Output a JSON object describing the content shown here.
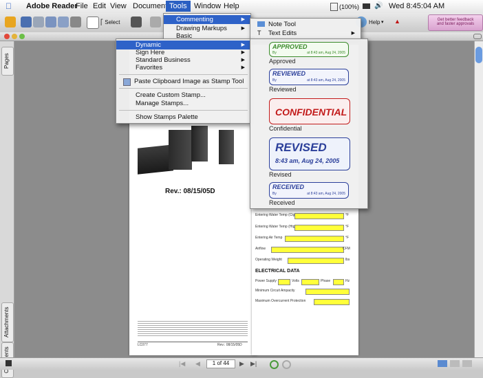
{
  "menubar": {
    "app": "Adobe Reader",
    "items": [
      "File",
      "Edit",
      "View",
      "Document",
      "Tools",
      "Window",
      "Help"
    ],
    "zoom": "(100%)",
    "clock": "Wed 8:45:04 AM"
  },
  "toolbar": {
    "select_label": "Select",
    "help_label": "Help",
    "promo_line1": "Get better feedback",
    "promo_line2": "and faster approvals"
  },
  "tools_menu": {
    "items": [
      {
        "label": "Commenting"
      },
      {
        "label": "Drawing Markups"
      },
      {
        "label": "Basic"
      }
    ]
  },
  "stamps_menu": {
    "items": [
      {
        "label": "Dynamic"
      },
      {
        "label": "Sign Here"
      },
      {
        "label": "Standard Business"
      },
      {
        "label": "Favorites"
      }
    ],
    "paste": "Paste Clipboard Image as Stamp Tool",
    "create": "Create Custom Stamp...",
    "manage": "Manage Stamps...",
    "palette": "Show Stamps Palette"
  },
  "commenting_menu": {
    "note": "Note Tool",
    "text_edits": "Text Edits"
  },
  "dynamic_stamps": [
    {
      "title": "APPROVED",
      "by": "By",
      "time": "at 8:43 am, Aug 24, 2005",
      "label": "Approved"
    },
    {
      "title": "REVIEWED",
      "by": "By",
      "time": "at 8:43 am, Aug 24, 2005",
      "label": "Reviewed"
    },
    {
      "title": "CONFIDENTIAL",
      "label": "Confidential"
    },
    {
      "title": "REVISED",
      "time": "8:43 am, Aug 24, 2005",
      "label": "Revised"
    },
    {
      "title": "RECEIVED",
      "by": "By",
      "time": "at 8:43 am, Aug 24, 2005",
      "label": "Received"
    }
  ],
  "document": {
    "rev": "Rev.: 08/15/05D",
    "footer_left": "LC077",
    "footer_right": "Rev.: 08/15/05D",
    "fields": [
      {
        "label": "Entering Water Temp (Clg)",
        "unit": "°F"
      },
      {
        "label": "Entering Water Temp (Htg)",
        "unit": "°F"
      },
      {
        "label": "Entering Air Temp",
        "unit": "°F"
      },
      {
        "label": "Airflow",
        "unit": "CFM"
      },
      {
        "label": "Operating Weight",
        "unit": "lbs"
      }
    ],
    "electrical_heading": "ELECTRICAL DATA",
    "power_supply": "Power Supply",
    "volts": "Volts",
    "phase": "Phase",
    "hz": "Hz",
    "min_circuit": "Minimum Circuit Ampacity",
    "max_overcurrent": "Maximum Overcurrent Protection"
  },
  "side_tabs": {
    "pages": "Pages",
    "attachments": "Attachments",
    "comments": "Comments"
  },
  "statusbar": {
    "page": "1 of 44"
  },
  "colors": {
    "menu_highlight": "#2e62c8",
    "approved": "#3a8a2a",
    "reviewed": "#2b3f9a",
    "confidential": "#c21a1a",
    "field": "#ffff3a"
  }
}
